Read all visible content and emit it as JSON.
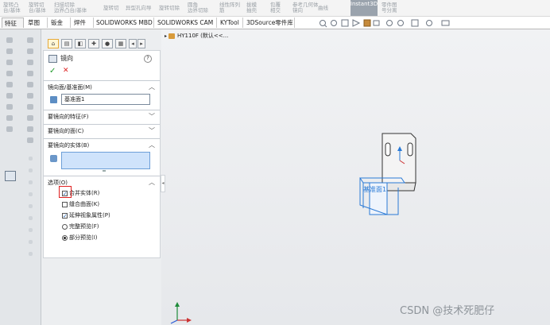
{
  "ribbon": {
    "items": [
      {
        "l1": "旋转凸",
        "l2": "台/基体"
      },
      {
        "l1": "旋转切",
        "l2": "台/基体"
      },
      {
        "l1": "扫描切除",
        "l2": "边界凸台/基体"
      },
      {
        "l1": "旋转切",
        "l2": ""
      },
      {
        "l1": "异型孔向导",
        "l2": ""
      },
      {
        "l1": "旋转切除",
        "l2": ""
      },
      {
        "l1": "圆角",
        "l2": "边界切除"
      },
      {
        "l1": "线性阵列",
        "l2": "筋"
      },
      {
        "l1": "拔模",
        "l2": "抽壳"
      },
      {
        "l1": "包覆",
        "l2": "相交"
      },
      {
        "l1": "参考几何体",
        "l2": "镜向"
      },
      {
        "l1": "曲线",
        "l2": ""
      }
    ],
    "instant3d": "Instant3D",
    "extra": {
      "l1": "零件图",
      "l2": "号分离"
    }
  },
  "tabs": [
    "特征",
    "草图",
    "钣金",
    "焊件",
    "SOLIDWORKS MBD",
    "SOLIDWORKS CAM",
    "KYTool",
    "3DSource零件库"
  ],
  "tree": {
    "root": "HY110F (默认<<..."
  },
  "panel": {
    "title": "镜向",
    "help": "?",
    "ok": "✓",
    "cancel": "✕",
    "mirror_plane_header": "镜向面/基准面(M)",
    "mirror_plane_value": "基准面1",
    "features_header": "要镜向的特征(F)",
    "faces_header": "要镜向的面(C)",
    "bodies_header": "要镜向的实体(B)",
    "options_header": "选项(O)",
    "options": [
      {
        "label": "合并实体(R)",
        "kind": "checkbox",
        "checked": true
      },
      {
        "label": "缝合曲面(K)",
        "kind": "checkbox",
        "checked": false
      },
      {
        "label": "延伸视象属性(P)",
        "kind": "checkbox",
        "checked": true
      },
      {
        "label": "完整预览(F)",
        "kind": "radio",
        "checked": false
      },
      {
        "label": "部分预览(I)",
        "kind": "radio",
        "checked": true
      }
    ]
  },
  "model": {
    "plane_label": "基准面1"
  },
  "watermark": "CSDN @技术死肥仔",
  "colors": {
    "highlight_box": "#e02020",
    "preview": "#2a7ad6",
    "selection_fill": "#cfe3fb"
  }
}
